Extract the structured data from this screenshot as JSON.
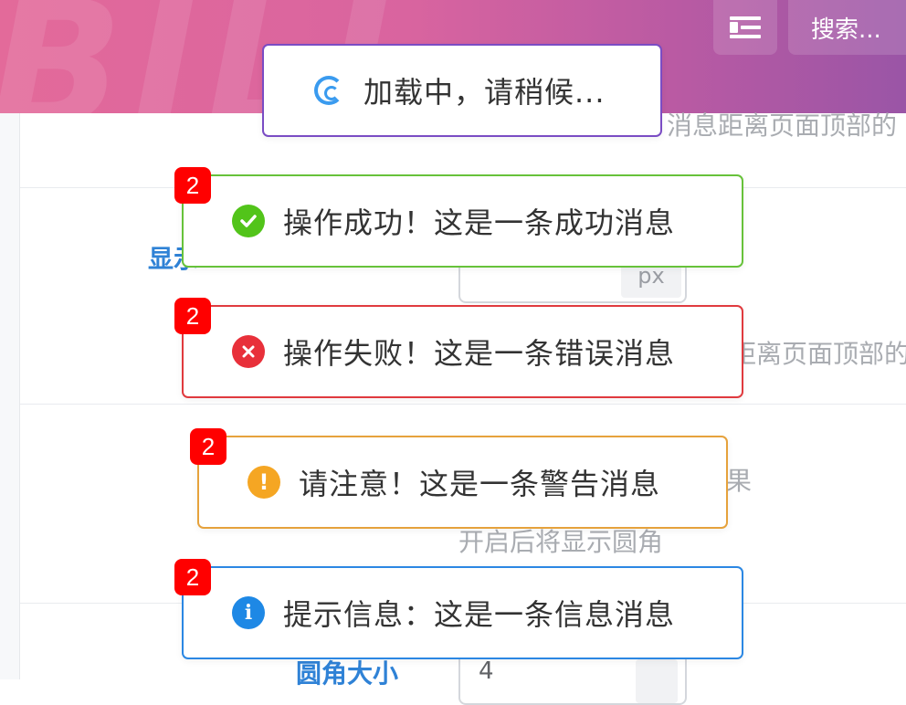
{
  "header": {
    "watermark": "BILI",
    "menu_icon": "menu-fold-icon",
    "search_label": "搜索..."
  },
  "background": {
    "hint_top": "消息距离页面顶部的",
    "label_offset": "显示",
    "offset_unit": "px",
    "hint_offset": "距离页面顶部的",
    "hint_effect": "果",
    "hint_rounded": "开启后将显示圆角",
    "label_radius": "圆角大小",
    "radius_value": "4"
  },
  "toasts": {
    "loading": {
      "text": "加载中，请稍候...",
      "color": "#7a4cc4",
      "icon": "loading-spinner-icon"
    },
    "success": {
      "text": "操作成功！这是一条成功消息",
      "badge": "2",
      "color": "#67c23a",
      "icon": "check-badge-icon"
    },
    "error": {
      "text": "操作失败！这是一条错误消息",
      "badge": "2",
      "color": "#e03a3e",
      "icon": "close-circle-icon"
    },
    "warning": {
      "text": "请注意！这是一条警告消息",
      "badge": "2",
      "color": "#e6a23c",
      "icon": "exclamation-circle-icon"
    },
    "info": {
      "text": "提示信息：这是一条信息消息",
      "badge": "2",
      "color": "#2b87e3",
      "icon": "info-circle-icon"
    }
  }
}
